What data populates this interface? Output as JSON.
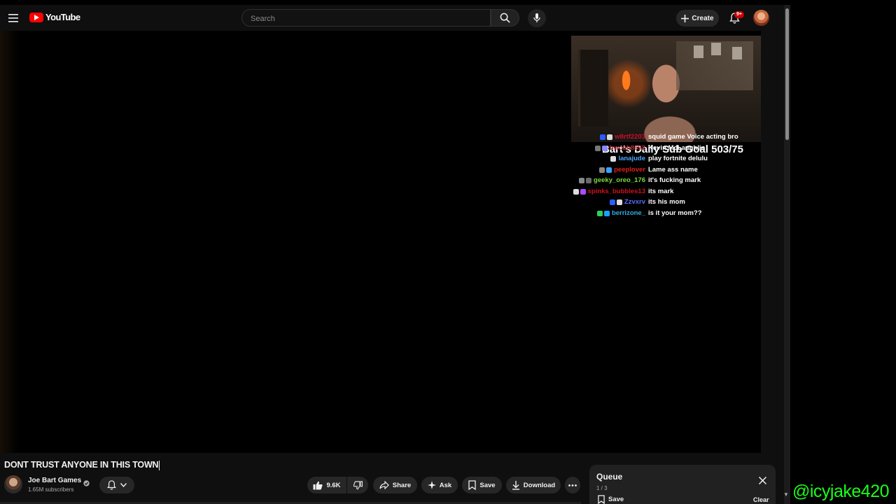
{
  "header": {
    "logo_text": "YouTube",
    "search_placeholder": "Search",
    "create_label": "Create",
    "notification_count": "9+"
  },
  "stream_overlay": {
    "sub_goal": "Bart's Daily Sub Goal 503/75",
    "chat": [
      {
        "user": "w8rtf2203",
        "message": "squid game Voice acting bro",
        "color": "#c8102e",
        "badges": [
          "#2a5cff",
          "#dddddd"
        ]
      },
      {
        "user": "bwoah8692",
        "message": "Kevin McLaughlin",
        "color": "#b0303a",
        "badges": [
          "#777777",
          "#8888ff"
        ]
      },
      {
        "user": "lanajude",
        "message": "play fortnite delulu",
        "color": "#4fa3ff",
        "badges": [
          "#dddddd"
        ]
      },
      {
        "user": "peeplover",
        "message": "Lame ass name",
        "color": "#e0201b",
        "badges": [
          "#888888",
          "#3aa0ff"
        ]
      },
      {
        "user": "geeky_oreo_176",
        "message": "it's fucking mark",
        "color": "#7bdc3a",
        "badges": [
          "#888888",
          "#6a6a6a"
        ]
      },
      {
        "user": "spinks_bubbles13",
        "message": "its mark",
        "color": "#d01020",
        "badges": [
          "#dddddd",
          "#b04aff"
        ]
      },
      {
        "user": "Zzvxrv",
        "message": "its his mom",
        "color": "#5b6dff",
        "badges": [
          "#2a5cff",
          "#dddddd"
        ]
      },
      {
        "user": "berrizone_",
        "message": "is it your mom??",
        "color": "#2fb0e0",
        "badges": [
          "#33cc55",
          "#1aa0ff"
        ]
      }
    ]
  },
  "video": {
    "title": "DONT TRUST ANYONE IN THIS TOWN",
    "channel_name": "Joe Bart Games",
    "subscribers": "1.65M subscribers",
    "like_count": "9.6K",
    "share_label": "Share",
    "ask_label": "Ask",
    "save_label": "Save",
    "download_label": "Download"
  },
  "queue": {
    "title": "Queue",
    "position": "1 / 3",
    "save_label": "Save",
    "clear_label": "Clear"
  },
  "watermark": "@icyjake420",
  "colors": {
    "background": "#0f0f0f",
    "brand_red": "#ff0000",
    "pill_bg": "#272727",
    "watermark_green": "#19ff19"
  }
}
